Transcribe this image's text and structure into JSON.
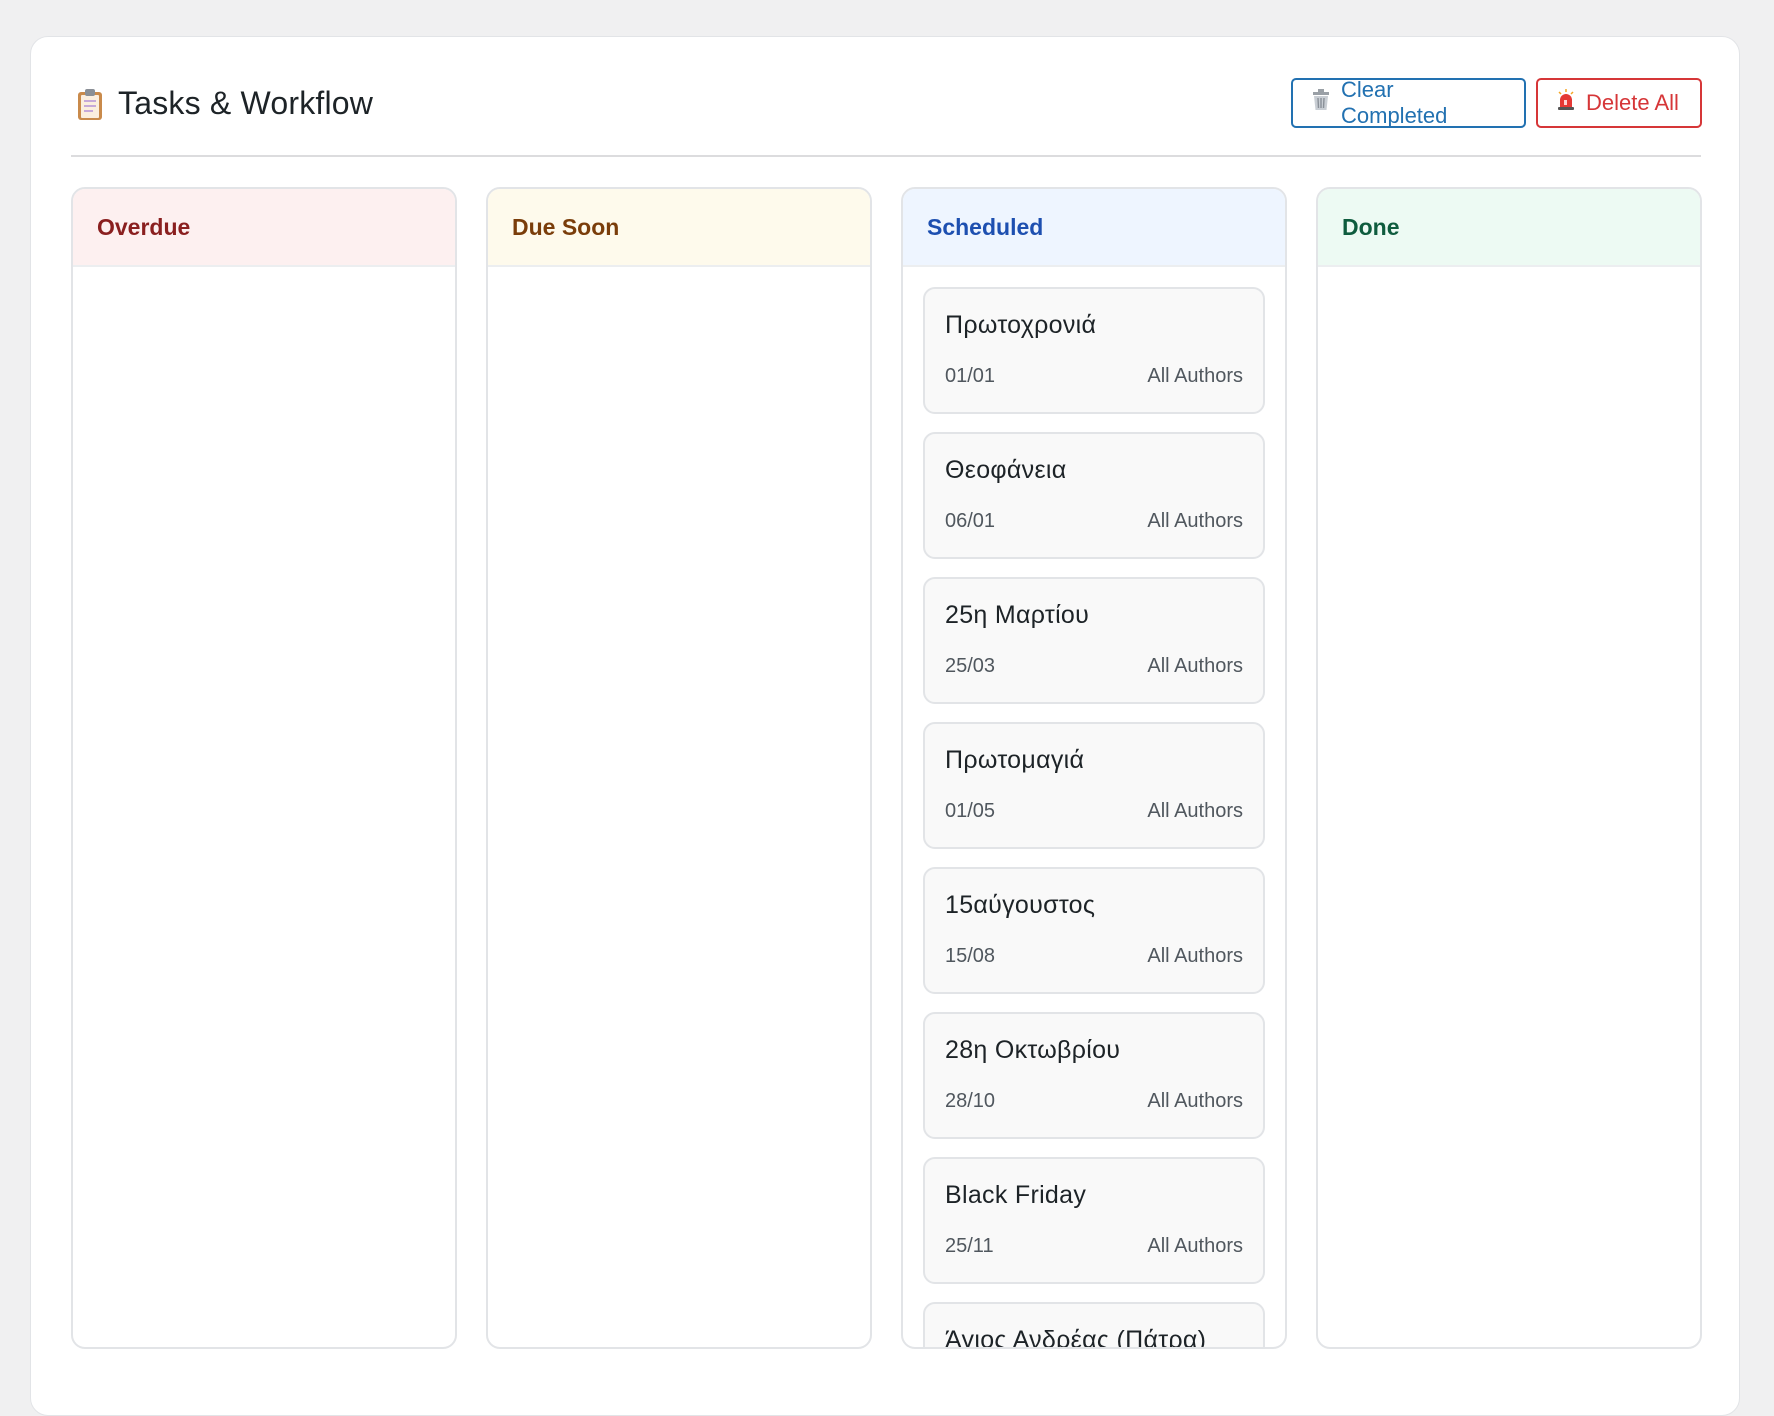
{
  "header": {
    "title": "Tasks & Workflow",
    "title_icon": "clipboard-icon",
    "clear_completed_label": "Clear Completed",
    "clear_completed_icon": "trash-icon",
    "delete_all_label": "Delete All",
    "delete_all_icon": "siren-icon"
  },
  "columns": [
    {
      "label": "Overdue",
      "color": "#8a1f1f",
      "bg": "#fdf0f0",
      "tasks": []
    },
    {
      "label": "Due Soon",
      "color": "#7a3d0a",
      "bg": "#fefaec",
      "tasks": []
    },
    {
      "label": "Scheduled",
      "color": "#1d4fb0",
      "bg": "#eef5ff",
      "tasks": [
        {
          "title": "Πρωτοχρονιά",
          "date": "01/01",
          "assignee": "All Authors"
        },
        {
          "title": "Θεοφάνεια",
          "date": "06/01",
          "assignee": "All Authors"
        },
        {
          "title": "25η Μαρτίου",
          "date": "25/03",
          "assignee": "All Authors"
        },
        {
          "title": "Πρωτομαγιά",
          "date": "01/05",
          "assignee": "All Authors"
        },
        {
          "title": "15αύγουστος",
          "date": "15/08",
          "assignee": "All Authors"
        },
        {
          "title": "28η Οκτωβρίου",
          "date": "28/10",
          "assignee": "All Authors"
        },
        {
          "title": "Black Friday",
          "date": "25/11",
          "assignee": "All Authors"
        },
        {
          "title": "Άγιος Ανδρέας (Πάτρα)",
          "date": "",
          "assignee": ""
        }
      ]
    },
    {
      "label": "Done",
      "color": "#0f5c3e",
      "bg": "#edfaf3",
      "tasks": []
    }
  ]
}
